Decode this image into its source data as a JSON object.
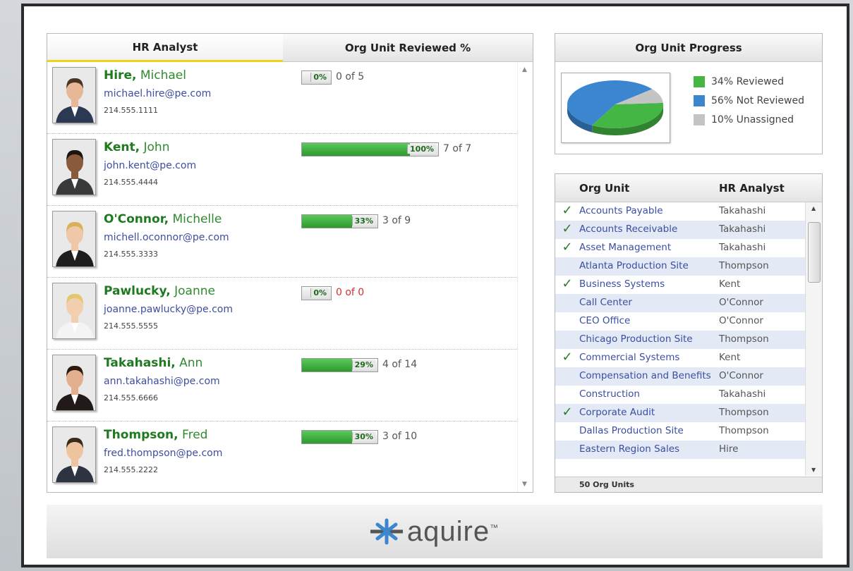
{
  "left_panel": {
    "col_analyst": "HR Analyst",
    "col_reviewed": "Org Unit Reviewed %",
    "analysts": [
      {
        "last": "Hire,",
        "first": "Michael",
        "email": "michael.hire@pe.com",
        "phone": "214.555.1111",
        "pct_label": "0%",
        "count": "0 of 5",
        "fraction": 0.0,
        "zero": false
      },
      {
        "last": "Kent,",
        "first": "John",
        "email": "john.kent@pe.com",
        "phone": "214.555.4444",
        "pct_label": "100%",
        "count": "7 of 7",
        "fraction": 1.0,
        "zero": false
      },
      {
        "last": "O'Connor,",
        "first": "Michelle",
        "email": "michell.oconnor@pe.com",
        "phone": "214.555.3333",
        "pct_label": "33%",
        "count": "3 of 9",
        "fraction": 0.33,
        "zero": false
      },
      {
        "last": "Pawlucky,",
        "first": "Joanne",
        "email": "joanne.pawlucky@pe.com",
        "phone": "214.555.5555",
        "pct_label": "0%",
        "count": "0 of 0",
        "fraction": 0.0,
        "zero": true
      },
      {
        "last": "Takahashi,",
        "first": "Ann",
        "email": "ann.takahashi@pe.com",
        "phone": "214.555.6666",
        "pct_label": "29%",
        "count": "4 of 14",
        "fraction": 0.29,
        "zero": false
      },
      {
        "last": "Thompson,",
        "first": "Fred",
        "email": "fred.thompson@pe.com",
        "phone": "214.555.2222",
        "pct_label": "30%",
        "count": "3 of 10",
        "fraction": 0.3,
        "zero": false
      }
    ]
  },
  "progress_panel": {
    "title": "Org Unit Progress",
    "legend": [
      {
        "label": "34% Reviewed",
        "color": "#44b644"
      },
      {
        "label": "56% Not Reviewed",
        "color": "#3b86cf"
      },
      {
        "label": "10% Unassigned",
        "color": "#c4c4c4"
      }
    ],
    "pie": [
      {
        "name": "Reviewed",
        "value": 34,
        "color": "#44b644"
      },
      {
        "name": "Not Reviewed",
        "value": 56,
        "color": "#3b86cf"
      },
      {
        "name": "Unassigned",
        "value": 10,
        "color": "#c4c4c4"
      }
    ]
  },
  "org_table": {
    "col_unit": "Org Unit",
    "col_analyst": "HR Analyst",
    "rows": [
      {
        "unit": "Accounts Payable",
        "analyst": "Takahashi",
        "checked": true
      },
      {
        "unit": "Accounts Receivable",
        "analyst": "Takahashi",
        "checked": true
      },
      {
        "unit": "Asset Management",
        "analyst": "Takahashi",
        "checked": true
      },
      {
        "unit": "Atlanta Production Site",
        "analyst": "Thompson",
        "checked": false
      },
      {
        "unit": "Business Systems",
        "analyst": "Kent",
        "checked": true
      },
      {
        "unit": "Call Center",
        "analyst": "O'Connor",
        "checked": false
      },
      {
        "unit": "CEO Office",
        "analyst": "O'Connor",
        "checked": false
      },
      {
        "unit": "Chicago Production Site",
        "analyst": "Thompson",
        "checked": false
      },
      {
        "unit": "Commercial Systems",
        "analyst": "Kent",
        "checked": true
      },
      {
        "unit": "Compensation and Benefits",
        "analyst": "O'Connor",
        "checked": false
      },
      {
        "unit": "Construction",
        "analyst": "Takahashi",
        "checked": false
      },
      {
        "unit": "Corporate Audit",
        "analyst": "Thompson",
        "checked": true
      },
      {
        "unit": "Dallas Production Site",
        "analyst": "Thompson",
        "checked": false
      },
      {
        "unit": "Eastern Region Sales",
        "analyst": "Hire",
        "checked": false
      }
    ],
    "footer": "50 Org Units",
    "check_glyph": "✓"
  },
  "brand": {
    "name": "aquire",
    "trademark": "™"
  }
}
